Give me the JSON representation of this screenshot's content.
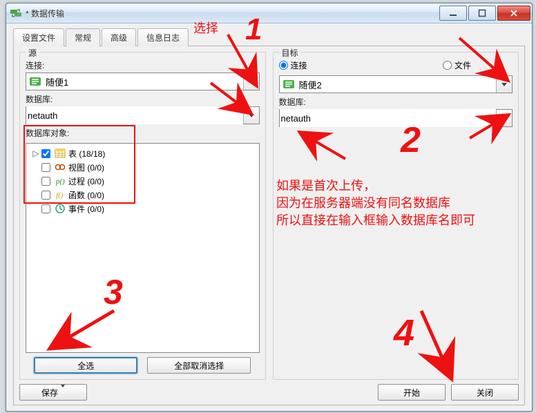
{
  "window": {
    "title": "* 数据传输"
  },
  "tabs": {
    "t0": "设置文件",
    "t1": "常规",
    "t2": "高级",
    "t3": "信息日志"
  },
  "source": {
    "legend": "源",
    "conn_label": "连接:",
    "conn_value": "随便1",
    "db_label": "数据库:",
    "db_value": "netauth",
    "objects_label": "数据库对象:"
  },
  "target": {
    "legend": "目标",
    "radio_conn": "连接",
    "radio_file": "文件",
    "conn_value": "随便2",
    "db_label": "数据库:",
    "db_value": "netauth"
  },
  "tree": {
    "tables": "表  (18/18)",
    "views": "视图  (0/0)",
    "procs": "过程  (0/0)",
    "funcs": "函数  (0/0)",
    "events": "事件  (0/0)"
  },
  "buttons": {
    "select_all": "全选",
    "deselect_all": "全部取消选择",
    "save": "保存",
    "start": "开始",
    "close": "关闭"
  },
  "annotations": {
    "select": "选择",
    "one": "1",
    "two": "2",
    "three": "3",
    "four": "4",
    "note_l1": "如果是首次上传，",
    "note_l2": "因为在服务器端没有同名数据库",
    "note_l3": "所以直接在输入框输入数据库名即可"
  }
}
